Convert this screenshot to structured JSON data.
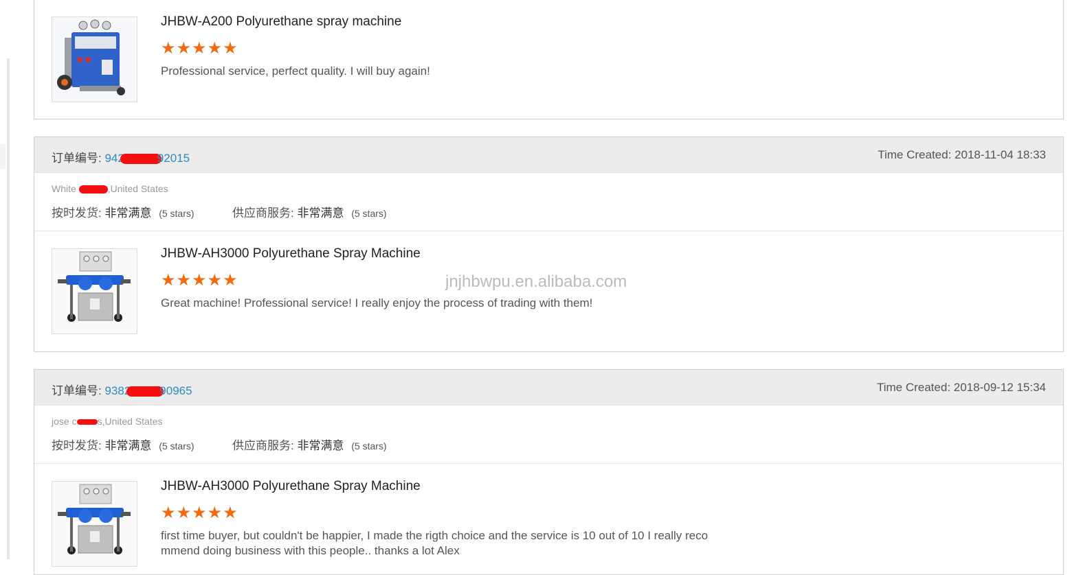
{
  "reviews": [
    {
      "product_name": "JHBW-A200 Polyurethane spray machine",
      "stars": "★★★★★",
      "comment": "Professional service, perfect quality. I will buy again!"
    },
    {
      "order_label": "订单编号:",
      "order_num_start": "942",
      "order_num_end": "92015",
      "time_created": "Time Created: 2018-11-04 18:33",
      "buyer_start": "White",
      "buyer_end": ",United States",
      "ontime_label": "按时发货:",
      "ontime_value": "非常满意",
      "ontime_stars": "(5 stars)",
      "service_label": "供应商服务:",
      "service_value": "非常满意",
      "service_stars": "(5 stars)",
      "product_name": "JHBW-AH3000 Polyurethane Spray Machine",
      "stars": "★★★★★",
      "comment": "Great machine! Professional service! I really enjoy the process of trading with them!"
    },
    {
      "order_label": "订单编号:",
      "order_num_start": "9382",
      "order_num_end": "90965",
      "time_created": "Time Created: 2018-09-12 15:34",
      "buyer_start": "jose c",
      "buyer_end": "s,United States",
      "ontime_label": "按时发货:",
      "ontime_value": "非常满意",
      "ontime_stars": "(5 stars)",
      "service_label": "供应商服务:",
      "service_value": "非常满意",
      "service_stars": "(5 stars)",
      "product_name": "JHBW-AH3000 Polyurethane Spray Machine",
      "stars": "★★★★★",
      "comment_line1": "first time buyer, but couldn't be happier, I made  the rigth choice and the service is 10 out of 10 I really reco",
      "comment_line2": "mmend doing business with this people.. thanks a lot Alex"
    }
  ],
  "rating_stars": 5,
  "watermark": "jnjhbwpu.en.alibaba.com",
  "colors": {
    "star": "#f26b10",
    "order_link": "#2f89c5",
    "header_bg": "#ececec"
  }
}
